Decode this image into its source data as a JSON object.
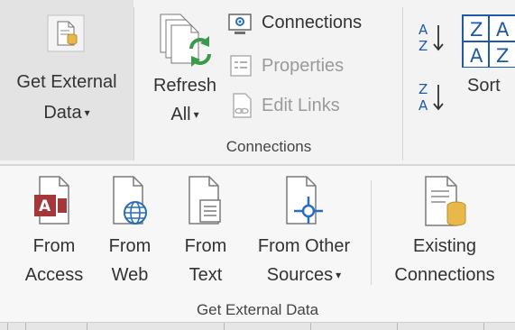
{
  "data_group": {
    "get_external_data": {
      "line1": "Get External",
      "line2": "Data",
      "caret": "▾"
    }
  },
  "connections_group": {
    "refresh_all": {
      "line1": "Refresh",
      "line2": "All",
      "caret": "▾"
    },
    "connections": "Connections",
    "properties": "Properties",
    "edit_links": "Edit Links",
    "group_label": "Connections"
  },
  "sort_group": {
    "sort": "Sort"
  },
  "get_external_data_group": {
    "from_access": {
      "line1": "From",
      "line2": "Access"
    },
    "from_web": {
      "line1": "From",
      "line2": "Web"
    },
    "from_text": {
      "line1": "From",
      "line2": "Text"
    },
    "from_other_sources": {
      "line1": "From Other",
      "line2": "Sources",
      "caret": "▾"
    },
    "existing_connections": {
      "line1": "Existing",
      "line2": "Connections"
    },
    "group_label": "Get External Data"
  },
  "colors": {
    "access_red": "#a4373a",
    "refresh_green": "#3a9a4a",
    "web_blue": "#2a6ebb",
    "db_gold": "#e8b94a",
    "sort_blue": "#1e5aa8"
  }
}
